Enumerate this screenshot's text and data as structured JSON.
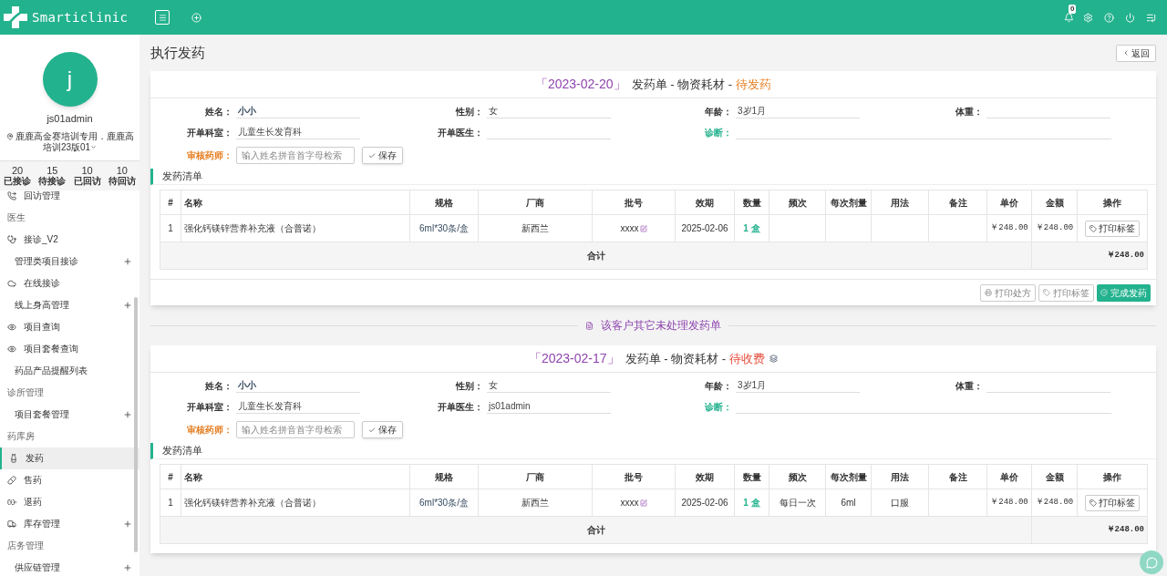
{
  "app": {
    "name": "Smarticlinic",
    "notifications": "0"
  },
  "profile": {
    "avatar_letter": "j",
    "username": "js01admin",
    "location": "鹿鹿高金赛培训专用．鹿鹿高培训23版01"
  },
  "stats": [
    {
      "value": "20",
      "label": "已接诊"
    },
    {
      "value": "15",
      "label": "待接诊"
    },
    {
      "value": "10",
      "label": "已回访"
    },
    {
      "value": "10",
      "label": "待回访"
    }
  ],
  "menu": [
    {
      "kind": "item",
      "label": "回访管理",
      "icon": true,
      "expandable": false,
      "selected": false
    },
    {
      "kind": "section",
      "label": "医生"
    },
    {
      "kind": "item",
      "label": "接诊_V2",
      "icon": true,
      "expandable": false,
      "selected": false
    },
    {
      "kind": "item",
      "label": "管理类项目接诊",
      "icon": false,
      "expandable": true,
      "selected": false
    },
    {
      "kind": "item",
      "label": "在线接诊",
      "icon": true,
      "expandable": false,
      "selected": false
    },
    {
      "kind": "item",
      "label": "线上身高管理",
      "icon": false,
      "expandable": true,
      "selected": false
    },
    {
      "kind": "item",
      "label": "项目查询",
      "icon": true,
      "expandable": false,
      "selected": false
    },
    {
      "kind": "item",
      "label": "项目套餐查询",
      "icon": true,
      "expandable": false,
      "selected": false
    },
    {
      "kind": "item",
      "label": "药品产品提醒列表",
      "icon": false,
      "expandable": false,
      "selected": false
    },
    {
      "kind": "section",
      "label": "诊所管理"
    },
    {
      "kind": "item",
      "label": "项目套餐管理",
      "icon": false,
      "expandable": true,
      "selected": false
    },
    {
      "kind": "section",
      "label": "药库房"
    },
    {
      "kind": "item",
      "label": "发药",
      "icon": true,
      "expandable": false,
      "selected": true
    },
    {
      "kind": "item",
      "label": "售药",
      "icon": true,
      "expandable": false,
      "selected": false
    },
    {
      "kind": "item",
      "label": "退药",
      "icon": true,
      "expandable": false,
      "selected": false
    },
    {
      "kind": "item",
      "label": "库存管理",
      "icon": true,
      "expandable": true,
      "selected": false
    },
    {
      "kind": "section",
      "label": "店务管理"
    },
    {
      "kind": "item",
      "label": "供应链管理",
      "icon": false,
      "expandable": true,
      "selected": false
    }
  ],
  "page": {
    "title": "执行发药",
    "back_button": "返回"
  },
  "orders": [
    {
      "date": "「2023-02-20」",
      "title": "发药单 - 物资耗材 -",
      "status": "待发药",
      "kind": "pending_dispense",
      "stack_icon": false,
      "columns": [
        "#",
        "名称",
        "规格",
        "厂商",
        "批号",
        "效期",
        "数量",
        "频次",
        "每次剂量",
        "用法",
        "备注",
        "单价",
        "金额",
        "操作"
      ],
      "fields": [
        {
          "kind": "name",
          "label": "姓名：",
          "value": "小小"
        },
        {
          "kind": "plain",
          "label": "性别：",
          "value": "女"
        },
        {
          "kind": "plain",
          "label": "年龄：",
          "value": "3岁1月"
        },
        {
          "kind": "plain",
          "label": "体重："
        },
        {
          "kind": "plain",
          "label": "开单科室：",
          "value": "儿童生长发育科"
        },
        {
          "kind": "plain",
          "label": "开单医生："
        },
        {
          "kind": "diagnosis",
          "label": "诊断："
        }
      ],
      "pharmacist": {
        "label": "审核药师：",
        "placeholder": "输入姓名拼音首字母检索",
        "button": "保存"
      },
      "list_title": "发药清单",
      "rows": [
        {
          "no": "1",
          "name": "强化钙镁锌营养补充液（合普诺）",
          "spec": "6ml*30条/盒",
          "maker": "新西兰",
          "batch": "xxxx",
          "expiry": "2025-02-06",
          "qty": "1 盒",
          "price": "￥248.00",
          "amount": "￥248.00",
          "action": "打印标签"
        }
      ],
      "total": {
        "label": "合计",
        "amount": "￥248.00"
      },
      "footer": [
        {
          "kind": "print",
          "label": "打印处方"
        },
        {
          "kind": "label",
          "label": "打印标签"
        },
        {
          "kind": "complete",
          "label": "完成发药"
        }
      ]
    },
    {
      "date": "「2023-02-17」",
      "title": "发药单 - 物资耗材 -",
      "status": "待收费",
      "kind": "pending_payment",
      "stack_icon": true,
      "columns": [
        "#",
        "名称",
        "规格",
        "厂商",
        "批号",
        "效期",
        "数量",
        "频次",
        "每次剂量",
        "用法",
        "备注",
        "单价",
        "金额",
        "操作"
      ],
      "fields": [
        {
          "kind": "name",
          "label": "姓名：",
          "value": "小小"
        },
        {
          "kind": "plain",
          "label": "性别：",
          "value": "女"
        },
        {
          "kind": "plain",
          "label": "年龄：",
          "value": "3岁1月"
        },
        {
          "kind": "plain",
          "label": "体重："
        },
        {
          "kind": "plain",
          "label": "开单科室：",
          "value": "儿童生长发育科"
        },
        {
          "kind": "plain",
          "label": "开单医生：",
          "value": "js01admin"
        },
        {
          "kind": "diagnosis",
          "label": "诊断："
        }
      ],
      "pharmacist": {
        "label": "审核药师：",
        "placeholder": "输入姓名拼音首字母检索",
        "button": "保存"
      },
      "list_title": "发药清单",
      "rows": [
        {
          "no": "1",
          "name": "强化钙镁锌营养补充液（合普诺）",
          "spec": "6ml*30条/盒",
          "maker": "新西兰",
          "batch": "xxxx",
          "expiry": "2025-02-06",
          "qty": "1 盒",
          "freq": "每日一次",
          "dose": "6ml",
          "usage": "口服",
          "price": "￥248.00",
          "amount": "￥248.00",
          "action": "打印标签"
        }
      ],
      "total": {
        "label": "合计",
        "amount": "￥248.00"
      }
    }
  ],
  "divider": "该客户其它未处理发药单"
}
